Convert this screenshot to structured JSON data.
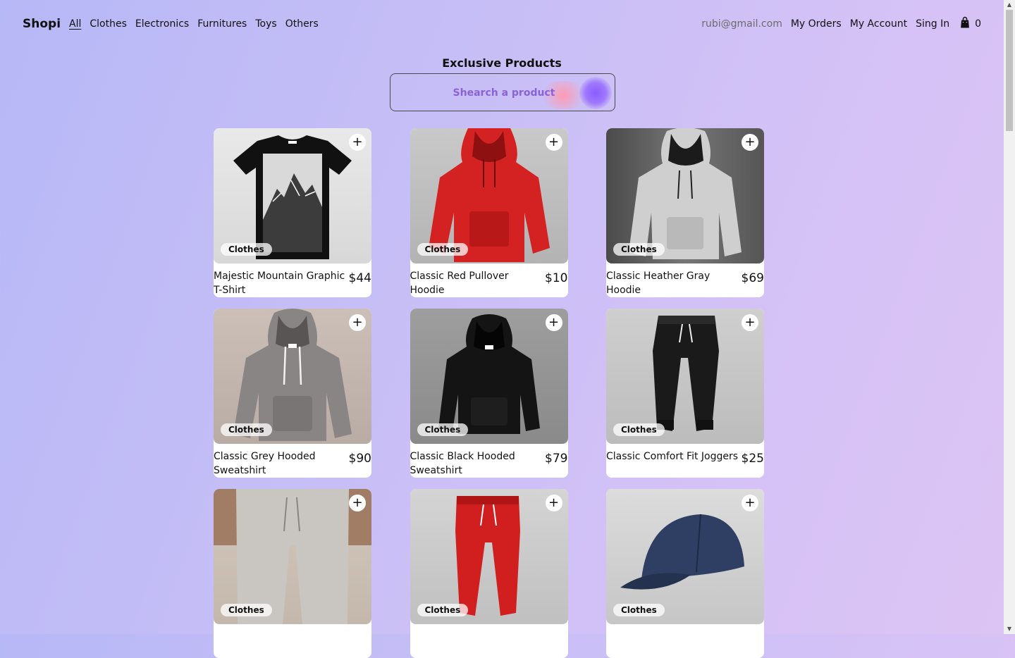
{
  "nav": {
    "brand": "Shopi",
    "categories": [
      "All",
      "Clothes",
      "Electronics",
      "Furnitures",
      "Toys",
      "Others"
    ],
    "email": "rubi@gmail.com",
    "my_orders": "My Orders",
    "my_account": "My Account",
    "sign_in": "Sing In",
    "cart_count": "0"
  },
  "page": {
    "title": "Exclusive Products",
    "search_placeholder": "Shearch a product"
  },
  "products": [
    {
      "name": "Majestic Mountain Graphic T-Shirt",
      "price": "$44",
      "category": "Clothes",
      "add": "+"
    },
    {
      "name": "Classic Red Pullover Hoodie",
      "price": "$10",
      "category": "Clothes",
      "add": "+"
    },
    {
      "name": "Classic Heather Gray Hoodie",
      "price": "$69",
      "category": "Clothes",
      "add": "+"
    },
    {
      "name": "Classic Grey Hooded Sweatshirt",
      "price": "$90",
      "category": "Clothes",
      "add": "+"
    },
    {
      "name": "Classic Black Hooded Sweatshirt",
      "price": "$79",
      "category": "Clothes",
      "add": "+"
    },
    {
      "name": "Classic Comfort Fit Joggers",
      "price": "$25",
      "category": "Clothes",
      "add": "+"
    },
    {
      "name": "",
      "price": "",
      "category": "Clothes",
      "add": "+"
    },
    {
      "name": "",
      "price": "",
      "category": "Clothes",
      "add": "+"
    },
    {
      "name": "",
      "price": "",
      "category": "Clothes",
      "add": "+"
    }
  ],
  "colors": {
    "accent_placeholder": "#8a62d6",
    "background_start": "#b7b8f7",
    "background_end": "#dcc4f4"
  }
}
